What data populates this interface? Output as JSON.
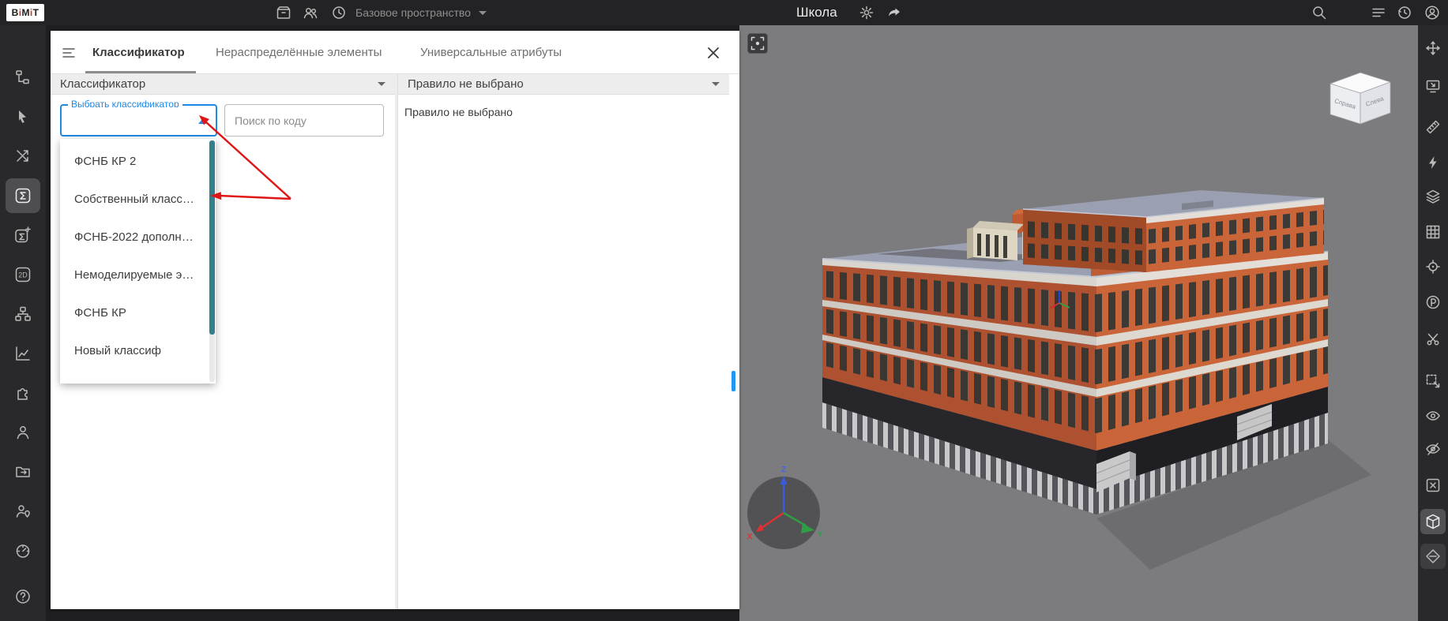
{
  "topbar": {
    "logo": "BiMiT",
    "workspace": {
      "value": "Базовое пространство"
    },
    "project_title": "Школа"
  },
  "panel": {
    "tabs": {
      "classifier": "Классификатор",
      "unallocated": "Нераспределённые элементы",
      "universal": "Универсальные атрибуты"
    },
    "classifier": {
      "header": "Классификатор",
      "select_label": "Выбрать классификатор",
      "select_value": "",
      "search_placeholder": "Поиск по коду",
      "dropdown_items": [
        "ФСНБ КР 2",
        "Собственный класс…",
        "ФСНБ-2022 дополн…",
        "Немоделируемые э…",
        "ФСНБ КР",
        "Новый классиф"
      ]
    },
    "rule": {
      "header": "Правило не выбрано",
      "empty_text": "Правило не выбрано"
    }
  },
  "viewport": {
    "view_cube": {
      "left_face": "Справа",
      "right_face": "Слева"
    },
    "axes": {
      "x": "X",
      "y": "Y",
      "z": "Z"
    }
  },
  "colors": {
    "accent_blue": "#2196f3",
    "focus_blue": "#1e88e5",
    "annotation_red": "#e01616",
    "scrollbar_teal": "#337f8d",
    "building_orange": "#c96539",
    "building_orange_dark": "#ad5130",
    "roof_gray": "#9aa0b2",
    "viewport_gray": "#7c7c7e"
  }
}
